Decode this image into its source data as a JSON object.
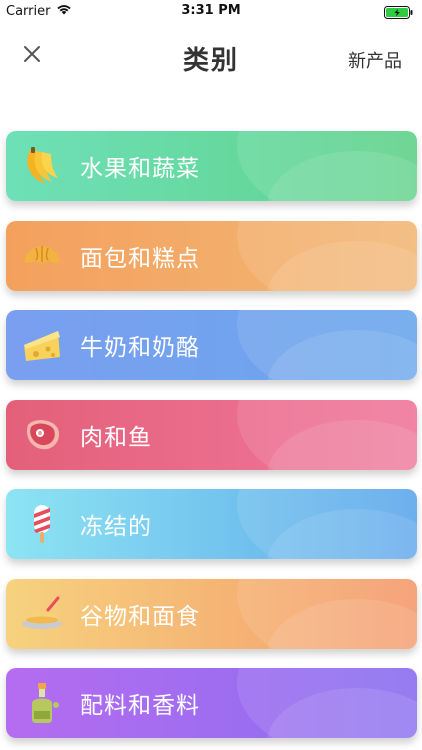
{
  "status_bar": {
    "carrier": "Carrier",
    "time": "3:31 PM",
    "icons": [
      "wifi-icon",
      "battery-icon"
    ]
  },
  "nav": {
    "close_icon": "close-icon",
    "title": "类别",
    "right_label": "新产品"
  },
  "categories": [
    {
      "label": "水果和蔬菜",
      "icon": "banana-icon",
      "colors": [
        "#6ee0b8",
        "#5fd28a"
      ]
    },
    {
      "label": "面包和糕点",
      "icon": "croissant-icon",
      "colors": [
        "#f4a05d",
        "#f2b877"
      ]
    },
    {
      "label": "牛奶和奶酪",
      "icon": "cheese-icon",
      "colors": [
        "#7a9ff0",
        "#6aa6ec"
      ]
    },
    {
      "label": "肉和鱼",
      "icon": "steak-icon",
      "colors": [
        "#e4607a",
        "#f0789c"
      ]
    },
    {
      "label": "冻结的",
      "icon": "popsicle-icon",
      "colors": [
        "#8de4f2",
        "#5da7ec"
      ]
    },
    {
      "label": "谷物和面食",
      "icon": "grain-bowl-icon",
      "colors": [
        "#f6d27e",
        "#f49a6c"
      ]
    },
    {
      "label": "配料和香料",
      "icon": "oil-bottle-icon",
      "colors": [
        "#b56cf0",
        "#8a6ef0"
      ]
    }
  ]
}
